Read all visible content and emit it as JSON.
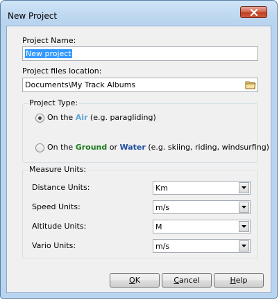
{
  "window": {
    "title": "New Project"
  },
  "project_name": {
    "label": "Project Name:",
    "value": "New project"
  },
  "location": {
    "label": "Project files location:",
    "value": "Documents\\My Track Albums"
  },
  "project_type": {
    "group_label": "Project Type:",
    "air": {
      "prefix": "On the",
      "highlight": "Air",
      "suffix": "(e.g. paragliding)",
      "selected": true
    },
    "ground": {
      "prefix": "On the",
      "highlight1": "Ground",
      "joiner": "or",
      "highlight2": "Water",
      "suffix": "(e.g. skiing, riding, windsurfing)",
      "selected": false
    }
  },
  "units": {
    "group_label": "Measure Units:",
    "distance": {
      "label": "Distance Units:",
      "value": "Km"
    },
    "speed": {
      "label": "Speed Units:",
      "value": "m/s"
    },
    "altitude": {
      "label": "Altitude Units:",
      "value": "M"
    },
    "vario": {
      "label": "Vario Units:",
      "value": "m/s"
    }
  },
  "buttons": {
    "ok": {
      "mnemonic": "O",
      "rest": "K"
    },
    "cancel": {
      "mnemonic": "C",
      "rest": "ancel"
    },
    "help": {
      "mnemonic": "H",
      "rest": "elp"
    }
  },
  "colors": {
    "air": "#5da6d6",
    "ground": "#1d7a1d",
    "water": "#1f4e9c",
    "selection": "#3399ff"
  }
}
